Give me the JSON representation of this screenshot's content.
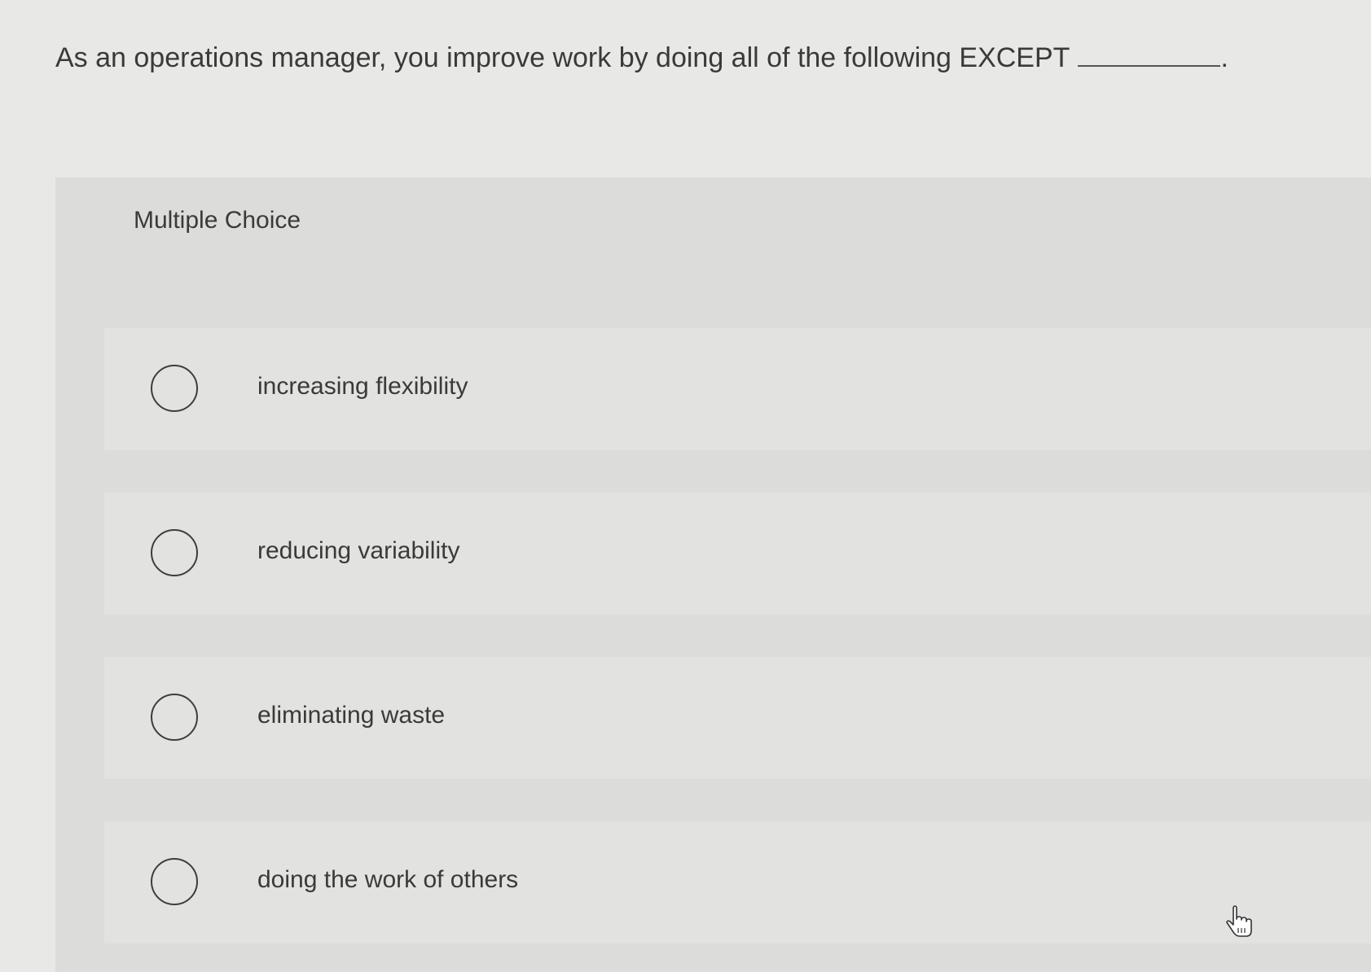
{
  "question": {
    "text": "As an operations manager, you improve work by doing all of the following EXCEPT",
    "suffix": "."
  },
  "section_label": "Multiple Choice",
  "options": [
    {
      "label": "increasing flexibility",
      "selected": false
    },
    {
      "label": "reducing variability",
      "selected": false
    },
    {
      "label": "eliminating waste",
      "selected": false
    },
    {
      "label": "doing the work of others",
      "selected": false
    }
  ],
  "icons": {
    "radio": "radio-circle-icon",
    "cursor": "hand-pointer-icon"
  }
}
